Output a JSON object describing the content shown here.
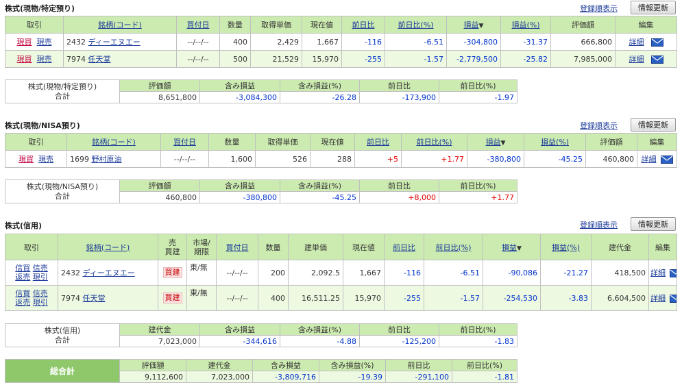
{
  "common": {
    "order_label": "登録順表示",
    "refresh_label": "情報更新",
    "detail_label": "詳細",
    "buy_badge": "買建",
    "colors": {
      "header_bg": "#ccebb0",
      "row_alt_bg": "#eef9e2",
      "negative": "#0033cc",
      "positive": "#e00000",
      "grand_label_bg": "#8ec86b"
    }
  },
  "s1": {
    "title": "株式(現物/特定預り)",
    "headers": [
      "取引",
      "銘柄(コード)",
      "買付日",
      "数量",
      "取得単価",
      "現在値",
      "前日比",
      "前日比(%)",
      "損益",
      "損益(%)",
      "評価額",
      "編集"
    ],
    "sort_mark": "▼",
    "rows": [
      {
        "buy": "現買",
        "sell": "現売",
        "code": "2432",
        "name": "ディーエヌエー",
        "date": "--/--/--",
        "qty": "400",
        "cost": "2,429",
        "price": "1,667",
        "chg": "-116",
        "chg_pct": "-6.51",
        "pl": "-304,800",
        "pl_pct": "-31.37",
        "value": "666,800"
      },
      {
        "buy": "現買",
        "sell": "現売",
        "code": "7974",
        "name": "任天堂",
        "date": "--/--/--",
        "qty": "500",
        "cost": "21,529",
        "price": "15,970",
        "chg": "-255",
        "chg_pct": "-1.57",
        "pl": "-2,779,500",
        "pl_pct": "-25.82",
        "value": "7,985,000"
      }
    ],
    "summary": {
      "label_line1": "株式(現物/特定預り)",
      "label_line2": "合計",
      "headers": [
        "評価額",
        "含み損益",
        "含み損益(%)",
        "前日比",
        "前日比(%)"
      ],
      "values": [
        "8,651,800",
        "-3,084,300",
        "-26.28",
        "-173,900",
        "-1.97"
      ]
    }
  },
  "s2": {
    "title": "株式(現物/NISA預り)",
    "headers": [
      "取引",
      "銘柄(コード)",
      "買付日",
      "数量",
      "取得単価",
      "現在値",
      "前日比",
      "前日比(%)",
      "損益",
      "損益(%)",
      "評価額",
      "編集"
    ],
    "sort_mark": "▼",
    "rows": [
      {
        "buy": "現買",
        "sell": "現売",
        "code": "1699",
        "name": "野村原油",
        "date": "--/--/--",
        "qty": "1,600",
        "cost": "526",
        "price": "288",
        "chg": "+5",
        "chg_pct": "+1.77",
        "pl": "-380,800",
        "pl_pct": "-45.25",
        "value": "460,800"
      }
    ],
    "summary": {
      "label_line1": "株式(現物/NISA預り)",
      "label_line2": "合計",
      "headers": [
        "評価額",
        "含み損益",
        "含み損益(%)",
        "前日比",
        "前日比(%)"
      ],
      "values": [
        "460,800",
        "-380,800",
        "-45.25",
        "+8,000",
        "+1.77"
      ]
    }
  },
  "s3": {
    "title": "株式(信用)",
    "headers": [
      "取引",
      "銘柄(コード)",
      "売買建",
      "市場/期限",
      "買付日",
      "数量",
      "建単価",
      "現在値",
      "前日比",
      "前日比(%)",
      "損益",
      "損益(%)",
      "建代金",
      "編集"
    ],
    "header_split": {
      "side_1": "売",
      "side_2": "買建",
      "market_1": "市場/",
      "market_2": "期限"
    },
    "sort_mark": "▼",
    "rows": [
      {
        "a1": "信買",
        "a2": "信売",
        "a3": "返売",
        "a4": "現引",
        "code": "2432",
        "name": "ディーエヌエー",
        "market": "東/無",
        "date": "--/--/--",
        "qty": "200",
        "cost": "2,092.5",
        "price": "1,667",
        "chg": "-116",
        "chg_pct": "-6.51",
        "pl": "-90,086",
        "pl_pct": "-21.27",
        "value": "418,500"
      },
      {
        "a1": "信買",
        "a2": "信売",
        "a3": "返売",
        "a4": "現引",
        "code": "7974",
        "name": "任天堂",
        "market": "東/無",
        "date": "--/--/--",
        "qty": "400",
        "cost": "16,511.25",
        "price": "15,970",
        "chg": "-255",
        "chg_pct": "-1.57",
        "pl": "-254,530",
        "pl_pct": "-3.83",
        "value": "6,604,500"
      }
    ],
    "summary": {
      "label_line1": "株式(信用)",
      "label_line2": "合計",
      "headers": [
        "建代金",
        "含み損益",
        "含み損益(%)",
        "前日比",
        "前日比(%)"
      ],
      "values": [
        "7,023,000",
        "-344,616",
        "-4.88",
        "-125,200",
        "-1.83"
      ]
    }
  },
  "grand": {
    "label": "総合計",
    "headers": [
      "評価額",
      "建代金",
      "含み損益",
      "含み損益(%)",
      "前日比",
      "前日比(%)"
    ],
    "values": [
      "9,112,600",
      "7,023,000",
      "-3,809,716",
      "-19.39",
      "-291,100",
      "-1.81"
    ]
  }
}
